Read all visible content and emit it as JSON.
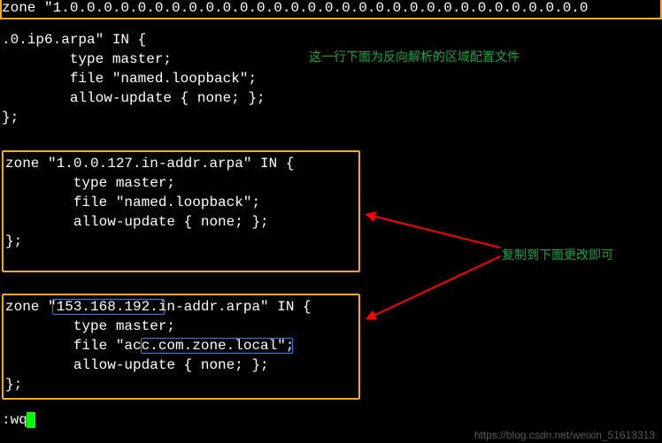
{
  "top_block": {
    "zone_header": "zone \"1.0.0.0.0.0.0.0.0.0.0.0.0.0.0.0.0.0.0.0.0.0.0.0.0.0.0.0.0.0.0.0",
    "l1": ".0.ip6.arpa\" IN {",
    "l2": "        type master;",
    "l3": "        file \"named.loopback\";",
    "l4": "        allow-update { none; };",
    "l5": "};"
  },
  "annotations": {
    "note_top": "这一行下面为反向解析的区域配置文件",
    "note_right": "复制到下面更改即可"
  },
  "mid_block": {
    "l1": "zone \"1.0.0.127.in-addr.arpa\" IN {",
    "l2": "        type master;",
    "l3": "        file \"named.loopback\";",
    "l4": "        allow-update { none; };",
    "l5": "};"
  },
  "bot_block": {
    "l1": "zone \"153.168.192.in-addr.arpa\" IN {",
    "l2": "        type master;",
    "l3": "        file \"acc.com.zone.local\";",
    "l4": "        allow-update { none; };",
    "l5": "};"
  },
  "highlights": {
    "changed_ip": "153.168.192.",
    "changed_file": "acc.com.zone.local"
  },
  "prompt": ":wq",
  "watermark": "https://blog.csdn.net/weixin_51613313"
}
